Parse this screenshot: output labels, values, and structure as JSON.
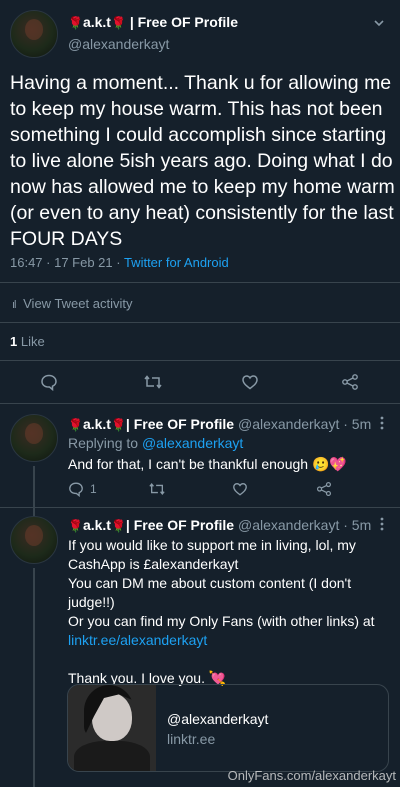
{
  "main_tweet": {
    "display_name": "a.k.t",
    "display_name_suffix": "| Free OF Profile",
    "handle": "@alexanderkayt",
    "text": "Having a moment... Thank u for allowing me to keep my house warm. This has not been something I could accomplish since starting to live alone 5ish years ago. Doing what I do now has allowed me to keep my home warm (or even to any heat) consistently for the last FOUR DAYS",
    "timestamp": "16:47 · 17 Feb 21 · ",
    "client": "Twitter for Android",
    "activity_label": "View Tweet activity",
    "likes_count": "1",
    "likes_label": "Like"
  },
  "reply_1": {
    "display_name": "a.k.t",
    "display_name_suffix": "| Free OF Profile",
    "handle": "@alexanderkayt · 5m",
    "replying_prefix": "Replying to ",
    "replying_handle": "@alexanderkayt",
    "text": "And for that, I can't be thankful enough",
    "emoji": "🥲💖",
    "reply_count": "1"
  },
  "reply_2": {
    "display_name": "a.k.t",
    "display_name_suffix": "| Free OF Profile",
    "handle": "@alexanderkayt · 5m",
    "line1": "If you would like to support me in living, lol, my CashApp is £alexanderkayt",
    "line2": "You can DM me about custom content (I don't judge!!)",
    "line3": "Or you can find my Only Fans (with other links) at",
    "link": "linktr.ee/alexanderkayt",
    "line4": "Thank you. I love you.",
    "emoji": "💘",
    "card": {
      "title": "@alexanderkayt",
      "domain": "linktr.ee"
    }
  },
  "watermark": "OnlyFans.com/alexanderkayt",
  "colors": {
    "background": "#15202b",
    "accent": "#1da1f2",
    "muted": "#8899a6",
    "divider": "#38444d",
    "rose": "#e0245e"
  }
}
